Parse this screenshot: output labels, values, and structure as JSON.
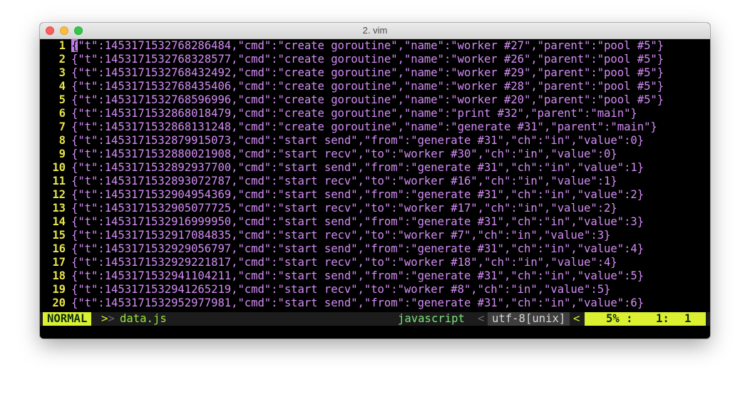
{
  "window": {
    "title": "2. vim"
  },
  "editor": {
    "lines": [
      {
        "n": "1",
        "text": "{\"t\":1453171532768286484,\"cmd\":\"create goroutine\",\"name\":\"worker #27\",\"parent\":\"pool #5\"}"
      },
      {
        "n": "2",
        "text": "{\"t\":1453171532768328577,\"cmd\":\"create goroutine\",\"name\":\"worker #26\",\"parent\":\"pool #5\"}"
      },
      {
        "n": "3",
        "text": "{\"t\":1453171532768432492,\"cmd\":\"create goroutine\",\"name\":\"worker #29\",\"parent\":\"pool #5\"}"
      },
      {
        "n": "4",
        "text": "{\"t\":1453171532768435406,\"cmd\":\"create goroutine\",\"name\":\"worker #28\",\"parent\":\"pool #5\"}"
      },
      {
        "n": "5",
        "text": "{\"t\":1453171532768596996,\"cmd\":\"create goroutine\",\"name\":\"worker #20\",\"parent\":\"pool #5\"}"
      },
      {
        "n": "6",
        "text": "{\"t\":1453171532868018479,\"cmd\":\"create goroutine\",\"name\":\"print #32\",\"parent\":\"main\"}"
      },
      {
        "n": "7",
        "text": "{\"t\":1453171532868131248,\"cmd\":\"create goroutine\",\"name\":\"generate #31\",\"parent\":\"main\"}"
      },
      {
        "n": "8",
        "text": "{\"t\":1453171532879915073,\"cmd\":\"start send\",\"from\":\"generate #31\",\"ch\":\"in\",\"value\":0}"
      },
      {
        "n": "9",
        "text": "{\"t\":1453171532880021908,\"cmd\":\"start recv\",\"to\":\"worker #30\",\"ch\":\"in\",\"value\":0}"
      },
      {
        "n": "10",
        "text": "{\"t\":1453171532892937700,\"cmd\":\"start send\",\"from\":\"generate #31\",\"ch\":\"in\",\"value\":1}"
      },
      {
        "n": "11",
        "text": "{\"t\":1453171532893072787,\"cmd\":\"start recv\",\"to\":\"worker #16\",\"ch\":\"in\",\"value\":1}"
      },
      {
        "n": "12",
        "text": "{\"t\":1453171532904954369,\"cmd\":\"start send\",\"from\":\"generate #31\",\"ch\":\"in\",\"value\":2}"
      },
      {
        "n": "13",
        "text": "{\"t\":1453171532905077725,\"cmd\":\"start recv\",\"to\":\"worker #17\",\"ch\":\"in\",\"value\":2}"
      },
      {
        "n": "14",
        "text": "{\"t\":1453171532916999950,\"cmd\":\"start send\",\"from\":\"generate #31\",\"ch\":\"in\",\"value\":3}"
      },
      {
        "n": "15",
        "text": "{\"t\":1453171532917084835,\"cmd\":\"start recv\",\"to\":\"worker #7\",\"ch\":\"in\",\"value\":3}"
      },
      {
        "n": "16",
        "text": "{\"t\":1453171532929056797,\"cmd\":\"start send\",\"from\":\"generate #31\",\"ch\":\"in\",\"value\":4}"
      },
      {
        "n": "17",
        "text": "{\"t\":1453171532929221817,\"cmd\":\"start recv\",\"to\":\"worker #18\",\"ch\":\"in\",\"value\":4}"
      },
      {
        "n": "18",
        "text": "{\"t\":1453171532941104211,\"cmd\":\"start send\",\"from\":\"generate #31\",\"ch\":\"in\",\"value\":5}"
      },
      {
        "n": "19",
        "text": "{\"t\":1453171532941265219,\"cmd\":\"start recv\",\"to\":\"worker #8\",\"ch\":\"in\",\"value\":5}"
      },
      {
        "n": "20",
        "text": "{\"t\":1453171532952977981,\"cmd\":\"start send\",\"from\":\"generate #31\",\"ch\":\"in\",\"value\":6}"
      }
    ]
  },
  "statusline": {
    "mode": "NORMAL",
    "sep_left": ">",
    "sep_left2": ">",
    "filename": "data.js",
    "filetype": "javascript",
    "sep_right": "<",
    "encoding": "utf-8[unix]",
    "sep_right2": "<",
    "percent": "5% :",
    "line": "1:",
    "col": "1"
  },
  "colors": {
    "line_number": "#e5e44b",
    "code_text": "#d38cf5",
    "status_accent": "#dcf032"
  }
}
